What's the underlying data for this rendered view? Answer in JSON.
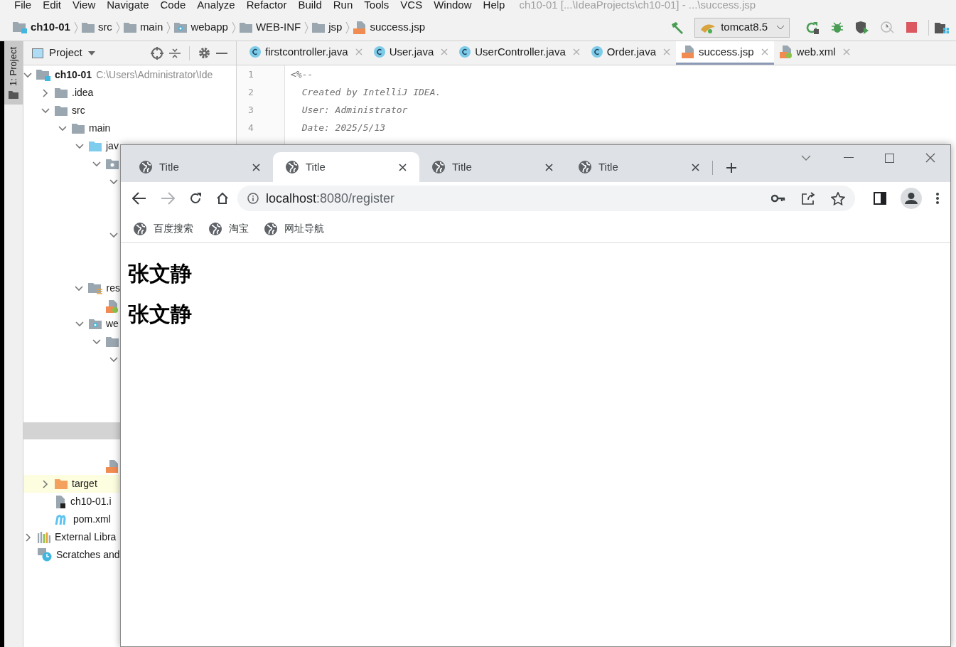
{
  "menu": [
    "File",
    "Edit",
    "View",
    "Navigate",
    "Code",
    "Analyze",
    "Refactor",
    "Build",
    "Run",
    "Tools",
    "VCS",
    "Window",
    "Help"
  ],
  "window_title": "ch10-01 [...\\IdeaProjects\\ch10-01] - ...\\success.jsp",
  "breadcrumbs": [
    {
      "label": "ch10-01",
      "kind": "module"
    },
    {
      "label": "src",
      "kind": "folder"
    },
    {
      "label": "main",
      "kind": "folder"
    },
    {
      "label": "webapp",
      "kind": "web"
    },
    {
      "label": "WEB-INF",
      "kind": "folder"
    },
    {
      "label": "jsp",
      "kind": "folder"
    },
    {
      "label": "success.jsp",
      "kind": "jsp"
    }
  ],
  "run_config": "tomcat8.5",
  "tool_stripe": {
    "label": "1: Project"
  },
  "project_panel": {
    "title": "Project",
    "tree": [
      {
        "label": "ch10-01",
        "path": "C:\\Users\\Administrator\\Ide",
        "kind": "module",
        "expanded": true,
        "children": [
          {
            "label": ".idea",
            "kind": "folder",
            "expanded": false
          },
          {
            "label": "src",
            "kind": "folder",
            "expanded": true,
            "children": [
              {
                "label": "main",
                "kind": "folder",
                "expanded": true,
                "children": [
                  {
                    "label": "jav",
                    "kind": "source",
                    "expanded": true,
                    "children": [
                      {
                        "kind": "package",
                        "expanded": true,
                        "children": [
                          {
                            "expanded": true
                          },
                          {
                            "expanded": true
                          }
                        ]
                      }
                    ]
                  },
                  {
                    "label": "res",
                    "kind": "resources",
                    "expanded": true,
                    "children": [
                      {
                        "kind": "xml"
                      }
                    ]
                  },
                  {
                    "label": "we",
                    "kind": "web",
                    "expanded": true,
                    "children": [
                      {
                        "kind": "folder",
                        "expanded": true,
                        "children": [
                          {
                            "expanded": true
                          }
                        ]
                      },
                      {
                        "kind": "jsp"
                      }
                    ]
                  }
                ]
              }
            ]
          },
          {
            "label": "target",
            "kind": "excluded",
            "expanded": false,
            "selected": true
          },
          {
            "label": "ch10-01.i",
            "kind": "iml"
          },
          {
            "label": "pom.xml",
            "kind": "maven"
          }
        ]
      },
      {
        "label": "External Libra",
        "kind": "library",
        "expanded": false
      },
      {
        "label": "Scratches and",
        "kind": "scratches"
      }
    ]
  },
  "editor_tabs": [
    {
      "label": "firstcontroller.java",
      "kind": "class",
      "selected": false
    },
    {
      "label": "User.java",
      "kind": "class",
      "selected": false
    },
    {
      "label": "UserController.java",
      "kind": "class",
      "selected": false
    },
    {
      "label": "Order.java",
      "kind": "class",
      "selected": false
    },
    {
      "label": "success.jsp",
      "kind": "jsp",
      "selected": true
    },
    {
      "label": "web.xml",
      "kind": "xml",
      "selected": false
    }
  ],
  "code_lines": [
    {
      "number": "1",
      "text": "<%--"
    },
    {
      "number": "2",
      "text": "  Created by IntelliJ IDEA."
    },
    {
      "number": "3",
      "text": "  User: Administrator"
    },
    {
      "number": "4",
      "text": "  Date: 2025/5/13"
    }
  ],
  "browser": {
    "tabs": [
      {
        "title": "Title",
        "selected": false
      },
      {
        "title": "Title",
        "selected": true
      },
      {
        "title": "Title",
        "selected": false
      },
      {
        "title": "Title",
        "selected": false
      }
    ],
    "address": {
      "host": "localhost",
      "rest": ":8080/register"
    },
    "bookmarks": [
      "百度搜索",
      "淘宝",
      "网址导航"
    ],
    "headings": [
      "张文静",
      "张文静"
    ]
  }
}
